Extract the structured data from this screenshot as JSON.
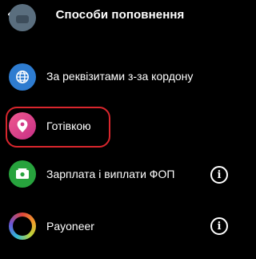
{
  "header": {
    "title": "Способи поповнення",
    "back_icon": "arrow-left-icon"
  },
  "items": [
    {
      "label": "",
      "icon": "partial-icon",
      "color": "#5a6e7e"
    },
    {
      "label": "За реквізитами з-за кордону",
      "icon": "globe-icon",
      "color": "#2e7cd0"
    },
    {
      "label": "Готівкою",
      "icon": "location-pin-icon",
      "color": "#e43f8e"
    },
    {
      "label": "Зарплата і виплати ФОП",
      "icon": "money-icon",
      "color": "#27a33d",
      "info_icon": "info-icon"
    },
    {
      "label": "Payoneer",
      "icon": "payoneer-ring-icon",
      "info_icon": "info-icon"
    }
  ],
  "colors": {
    "background": "#000000",
    "highlight": "#d9262d"
  }
}
